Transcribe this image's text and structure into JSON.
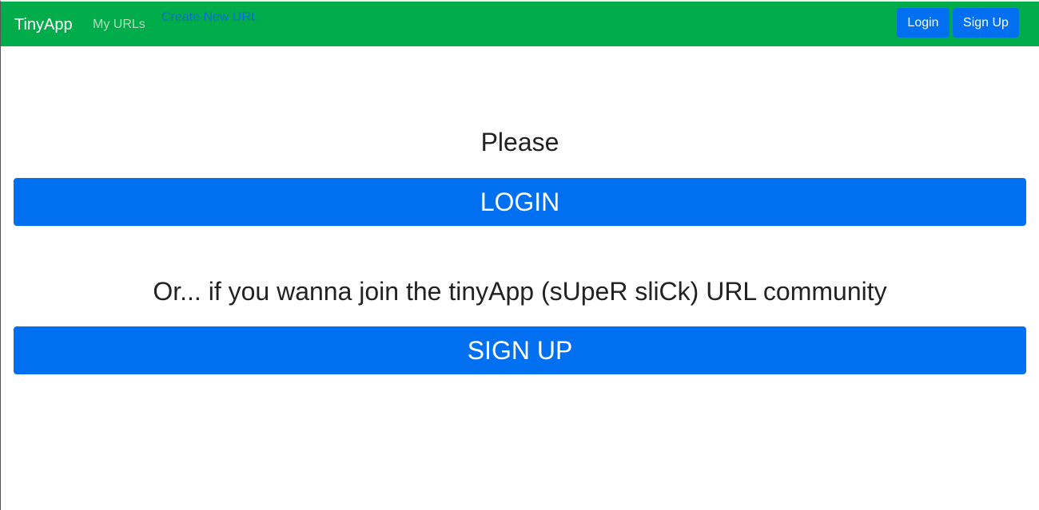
{
  "navbar": {
    "brand": "TinyApp",
    "links": {
      "my_urls": "My URLs",
      "create_new_url": "Create New URL"
    },
    "buttons": {
      "login": "Login",
      "signup": "Sign Up"
    },
    "colors": {
      "background": "#00ad4a",
      "button": "#0070f0"
    }
  },
  "main": {
    "please_text": "Please",
    "login_button": "LOGIN",
    "or_text": "Or... if you wanna join the tinyApp (sUpeR sliCk) URL community",
    "signup_button": "SIGN UP"
  }
}
